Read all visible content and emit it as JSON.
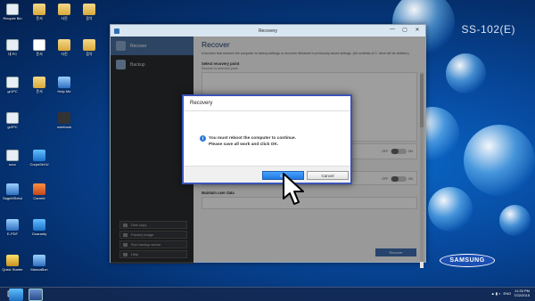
{
  "desktop": {
    "icons": [
      {
        "label": "Recycle Bin",
        "glyph": "recycle-bin-icon"
      },
      {
        "label": "문서",
        "glyph": "folder-icon"
      },
      {
        "label": "사진",
        "glyph": "folder-icon"
      },
      {
        "label": "음악",
        "glyph": "folder-icon"
      },
      {
        "label": "내 PC",
        "glyph": "computer-icon"
      },
      {
        "label": "문서",
        "glyph": "document-icon"
      },
      {
        "label": "사진",
        "glyph": "folder-icon"
      },
      {
        "label": "음악",
        "glyph": "folder-icon"
      },
      {
        "label": "gr1PC",
        "glyph": "computer-icon"
      },
      {
        "label": "문서",
        "glyph": "folder-icon"
      },
      {
        "label": "Help Me",
        "glyph": "help-icon"
      },
      {
        "label": "gr2PC",
        "glyph": "computer-icon"
      },
      {
        "label": "notebook",
        "glyph": "notebook-icon"
      },
      {
        "label": "sccc",
        "glyph": "computer-icon"
      },
      {
        "label": "CorpsSeVU",
        "glyph": "network-icon"
      },
      {
        "label": "SageMSetuI",
        "glyph": "app-icon"
      },
      {
        "label": "Carrete",
        "glyph": "app-icon"
      },
      {
        "label": "E-PDF",
        "glyph": "laptop-icon"
      },
      {
        "label": "Guaranty",
        "glyph": "app-icon"
      },
      {
        "label": "Quick Starter",
        "glyph": "quick-starter-icon"
      },
      {
        "label": "ManuaBon",
        "glyph": "manual-icon"
      }
    ],
    "watermark": "SS-102(E)",
    "brand": "SAMSUNG"
  },
  "window": {
    "title": "Recovery",
    "controls": [
      "—",
      "▢",
      "✕"
    ],
    "sidebar": {
      "nav": [
        {
          "label": "Recover",
          "active": true
        },
        {
          "label": "Backup",
          "active": false
        }
      ],
      "buttons": [
        "Disk copy",
        "Factory image",
        "Run backup server",
        "Help"
      ]
    },
    "content": {
      "heading": "Recover",
      "description": "A function that restores the computer to factory settings or recovers Windows to previously saved settings. (All contents of C: drive will be deleted.)",
      "section1_title": "Select recovery point",
      "section1_sub": "Recover to selected point",
      "section2_desc": "Delete data from the recovery... of the hard disk.",
      "section3_title": "Partition settings",
      "section3_sub": "When the partition is set, all the data on the drive will be deleted.",
      "section4_title": "Maintain user data",
      "toggle_off": "OFF",
      "toggle_on": "ON",
      "recover_button": "Recover"
    }
  },
  "dialog": {
    "title": "Recovery",
    "message_line1": "You must reboot the computer to continue.",
    "message_line2": "Please save all work and click OK.",
    "ok_label": "OK",
    "cancel_label": "Cancel"
  },
  "taskbar": {
    "start_glyph": "⊞",
    "language": "ENG",
    "time": "11:33 PM",
    "date": "7/22/2015"
  },
  "colors": {
    "desktop_bg": "#074aa0",
    "dialog_border": "#3a54b8",
    "ok_button": "#1f78e0",
    "sidebar_active": "#4a6f9e"
  }
}
